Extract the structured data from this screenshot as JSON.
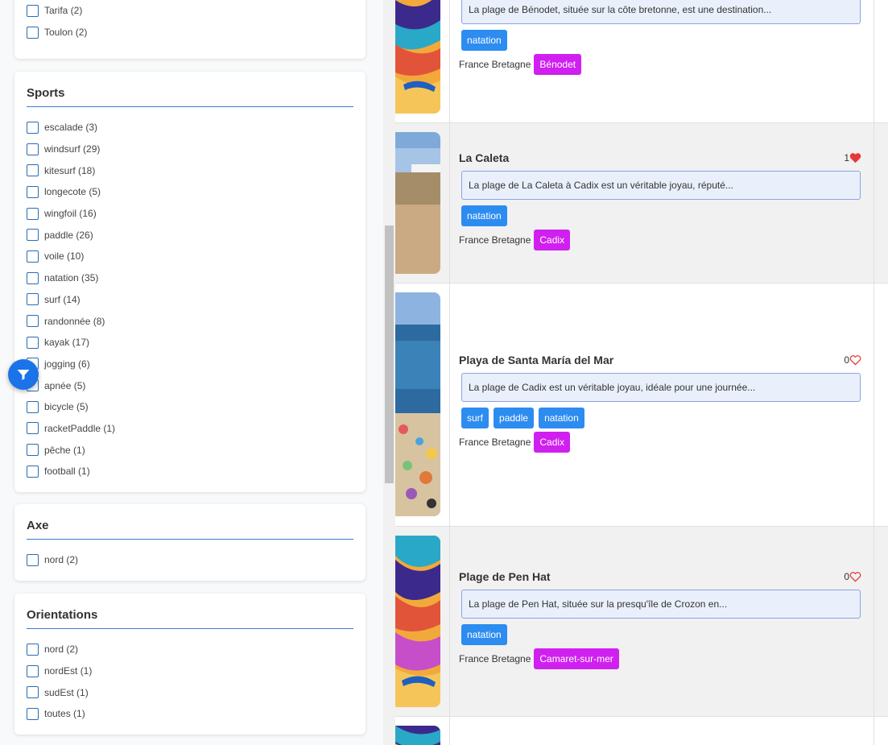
{
  "filters": {
    "cities_partial": [
      {
        "label": "Tarifa (2)"
      },
      {
        "label": "Toulon (2)"
      }
    ],
    "sports": {
      "title": "Sports",
      "items": [
        {
          "label": "escalade (3)"
        },
        {
          "label": "windsurf (29)"
        },
        {
          "label": "kitesurf (18)"
        },
        {
          "label": "longecote (5)"
        },
        {
          "label": "wingfoil (16)"
        },
        {
          "label": "paddle (26)"
        },
        {
          "label": "voile (10)"
        },
        {
          "label": "natation (35)"
        },
        {
          "label": "surf (14)"
        },
        {
          "label": "randonnée (8)"
        },
        {
          "label": "kayak (17)"
        },
        {
          "label": "jogging (6)"
        },
        {
          "label": "apnée (5)"
        },
        {
          "label": "bicycle (5)"
        },
        {
          "label": "racketPaddle (1)"
        },
        {
          "label": "pêche (1)"
        },
        {
          "label": "football (1)"
        }
      ]
    },
    "axe": {
      "title": "Axe",
      "items": [
        {
          "label": "nord (2)"
        }
      ]
    },
    "orientations": {
      "title": "Orientations",
      "items": [
        {
          "label": "nord (2)"
        },
        {
          "label": "nordEst (1)"
        },
        {
          "label": "sudEst (1)"
        },
        {
          "label": "toutes (1)"
        }
      ]
    }
  },
  "results": [
    {
      "title": "",
      "description": "La plage de Bénodet, située sur la côte bretonne, est une destination...",
      "tags": [
        "natation"
      ],
      "country": "France Bretagne",
      "city": "Bénodet"
    },
    {
      "title": "La Caleta",
      "likes": "1",
      "liked": true,
      "description": "La plage de La Caleta à Cadix est un véritable joyau, réputé...",
      "tags": [
        "natation"
      ],
      "country": "France Bretagne",
      "city": "Cadix"
    },
    {
      "title": "Playa de Santa María del Mar",
      "likes": "0",
      "liked": false,
      "description": "La plage de Cadix est un véritable joyau, idéale pour une journée...",
      "tags": [
        "surf",
        "paddle",
        "natation"
      ],
      "country": "France Bretagne",
      "city": "Cadix"
    },
    {
      "title": "Plage de Pen Hat",
      "likes": "0",
      "liked": false,
      "description": "La plage de Pen Hat, située sur la presqu'île de Crozon en...",
      "tags": [
        "natation"
      ],
      "country": "France Bretagne",
      "city": "Camaret-sur-mer"
    }
  ],
  "colors": {
    "accent": "#2d8cf0",
    "city_badge": "#d020f0",
    "heart": "#e53935",
    "fab": "#1a73e8"
  }
}
